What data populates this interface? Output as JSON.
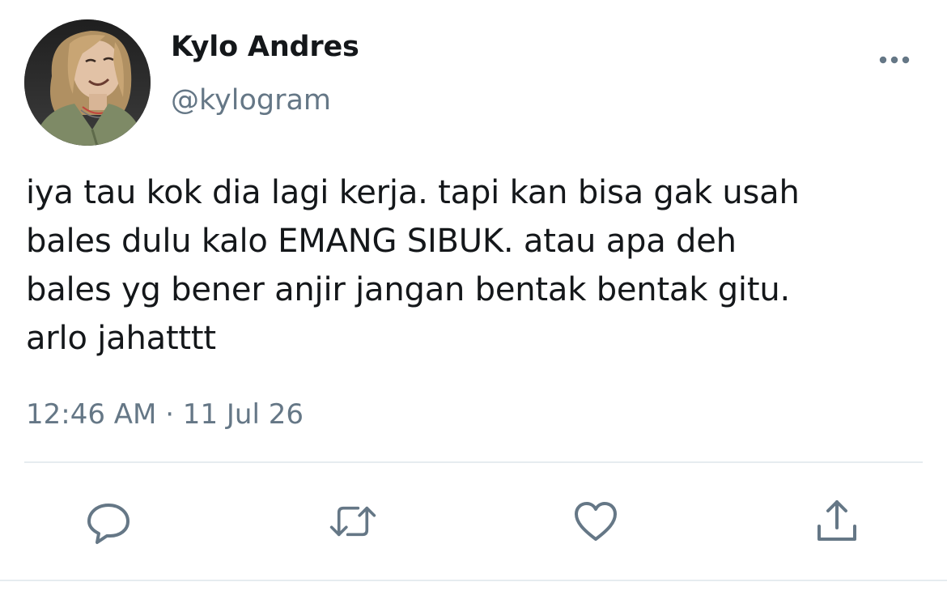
{
  "tweet": {
    "display_name": "Kylo Andres",
    "handle": "@kylogram",
    "text_lines": [
      "iya tau kok dia lagi kerja. tapi kan bisa gak usah",
      "bales dulu kalo EMANG SIBUK. atau apa deh",
      "bales yg bener anjir jangan bentak bentak gitu.",
      "arlo jahatttt"
    ],
    "timestamp": "12:46 AM · 11 Jul 26"
  },
  "actions": [
    {
      "name": "reply",
      "icon": "comment-icon"
    },
    {
      "name": "retweet",
      "icon": "retweet-icon"
    },
    {
      "name": "like",
      "icon": "heart-icon"
    },
    {
      "name": "share",
      "icon": "share-icon"
    }
  ],
  "colors": {
    "text_primary": "#14171a",
    "text_secondary": "#657786",
    "icon": "#657786",
    "divider": "#e6ecf0",
    "background": "#ffffff"
  }
}
